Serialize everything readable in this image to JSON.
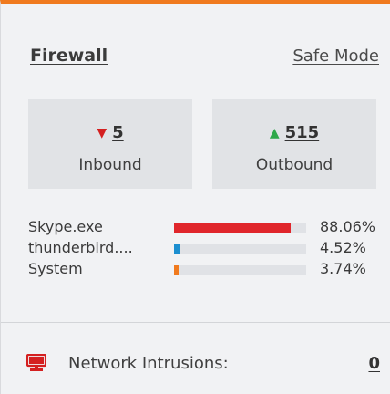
{
  "header": {
    "title": "Firewall",
    "safe_mode_label": "Safe Mode"
  },
  "stats": {
    "inbound": {
      "value": "5",
      "label": "Inbound",
      "arrow_icon": "triangle-down-icon",
      "arrow_color": "#d42020"
    },
    "outbound": {
      "value": "515",
      "label": "Outbound",
      "arrow_icon": "triangle-up-icon",
      "arrow_color": "#2ea84a"
    }
  },
  "apps": [
    {
      "name": "Skype.exe",
      "percent_text": "88.06%",
      "fraction": 0.8806,
      "color": "#e0262b"
    },
    {
      "name": "thunderbird....",
      "percent_text": "4.52%",
      "fraction": 0.0452,
      "color": "#1c8fd0"
    },
    {
      "name": "System",
      "percent_text": "3.74%",
      "fraction": 0.0374,
      "color": "#f07a1e"
    }
  ],
  "intrusions": {
    "label": "Network Intrusions:",
    "count": "0",
    "icon": "monitor-icon",
    "icon_color": "#d42020"
  },
  "colors": {
    "accent_top_border": "#f07a1e"
  }
}
